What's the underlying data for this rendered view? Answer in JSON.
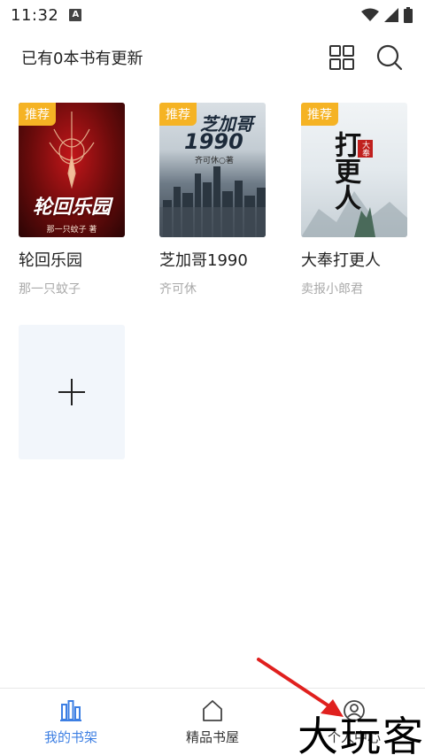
{
  "status_bar": {
    "time": "11:32",
    "notification_badge": "A"
  },
  "header": {
    "title": "已有0本书有更新",
    "grid_icon": "grid-icon",
    "search_icon": "search-icon"
  },
  "books": [
    {
      "badge": "推荐",
      "title": "轮回乐园",
      "author": "那一只蚊子",
      "cover_text": "轮回乐园",
      "cover_subtext": "那一只蚊子 著"
    },
    {
      "badge": "推荐",
      "title": "芝加哥1990",
      "author": "齐可休",
      "cover_text": "芝加哥",
      "cover_number": "1990",
      "cover_subtext": "齐可休○著"
    },
    {
      "badge": "推荐",
      "title": "大奉打更人",
      "author": "卖报小郎君",
      "cover_text": "打更人",
      "cover_badge": "大奉"
    }
  ],
  "add_book": {
    "icon": "plus-icon"
  },
  "bottom_nav": [
    {
      "label": "我的书架",
      "icon": "bookshelf-icon",
      "active": true
    },
    {
      "label": "精品书屋",
      "icon": "home-icon",
      "active": false
    },
    {
      "label": "个人中心",
      "icon": "profile-icon",
      "active": false
    }
  ],
  "watermark": "大玩客",
  "colors": {
    "accent": "#3d7fe3",
    "badge": "#f5b324",
    "arrow": "#e0201e"
  }
}
